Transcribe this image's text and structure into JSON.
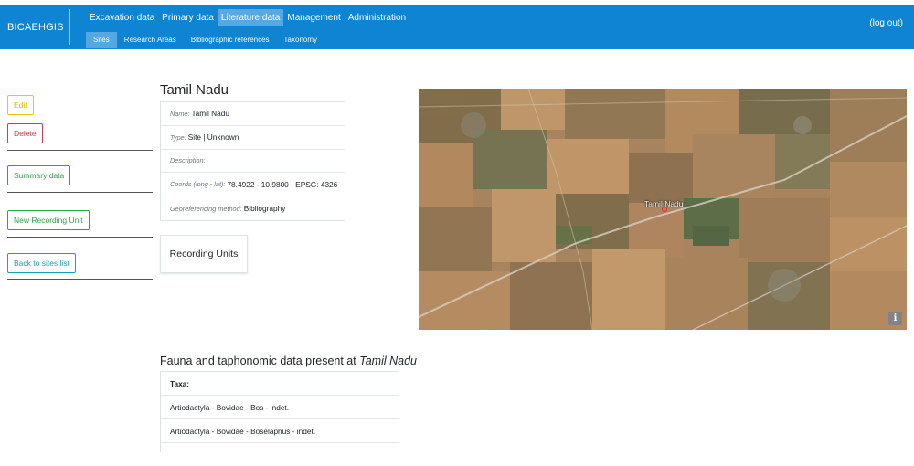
{
  "brand": "BICAEHGIS",
  "nav": {
    "items": [
      "Excavation data",
      "Primary data",
      "Literature data",
      "Management",
      "Administration"
    ],
    "sub_items": [
      "Sites",
      "Research Areas",
      "Bibliographic references",
      "Taxonomy"
    ],
    "logout": "(log out)"
  },
  "sidebar": {
    "edit": "Edit",
    "delete": "Delete",
    "summary": "Summary data",
    "new_recording_unit": "New Recording Unit",
    "back": "Back to sites list"
  },
  "site": {
    "title": "Tamil Nadu",
    "name_label": "Name:",
    "name": "Tamil Nadu",
    "type_label": "Type:",
    "type": "Site | Unknown",
    "description_label": "Description:",
    "description": "",
    "coords_label": "Coords (long - lat):",
    "coords": "78.4922 - 10.9800 - EPSG: 4326",
    "geo_label": "Georeferencing method:",
    "geo": "Bibliography"
  },
  "recording_units": {
    "title": "Recording Units"
  },
  "map": {
    "label": "Tamil Nadu",
    "info": "i"
  },
  "fauna": {
    "title_prefix": "Fauna and taphonomic data present at",
    "site": "Tamil Nadu",
    "header": "Taxa:",
    "rows": [
      "Artiodactyla - Bovidae - Bos - indet.",
      "Artiodactyla - Bovidae - Boselaphus - indet."
    ]
  },
  "colors": {
    "navbar": "#0f84d3",
    "active": "#5aa8e2",
    "warning": "#f1c40f",
    "danger": "#dc3545",
    "success": "#28a745",
    "info": "#17a2b8"
  }
}
